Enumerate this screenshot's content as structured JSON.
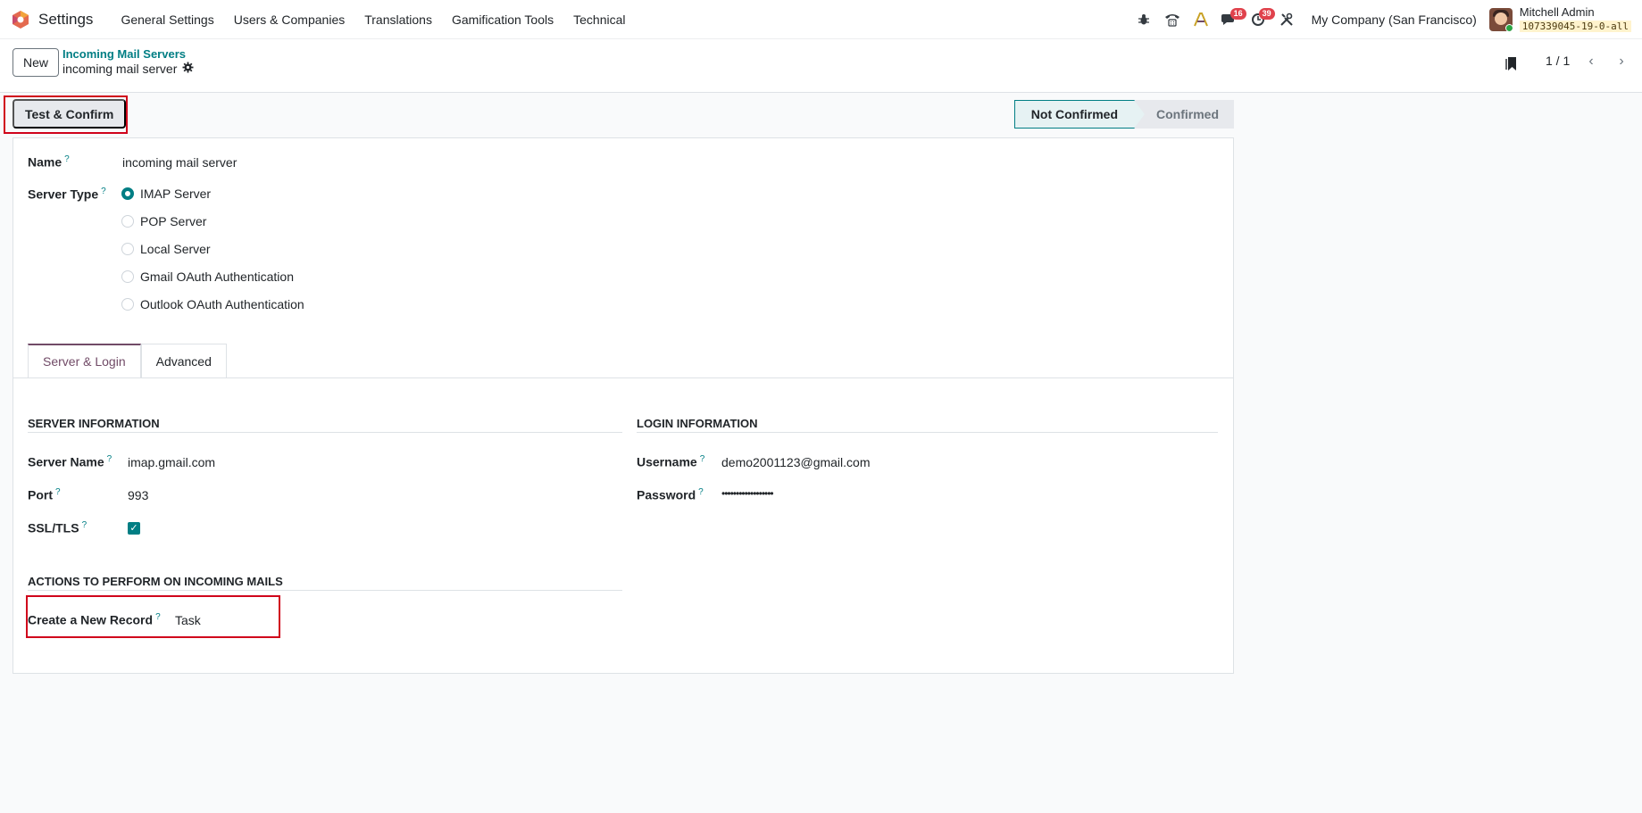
{
  "navbar": {
    "app_name": "Settings",
    "menu": [
      "General Settings",
      "Users & Companies",
      "Translations",
      "Gamification Tools",
      "Technical"
    ],
    "icons": [
      "bug-icon",
      "phone-icon",
      "ai-icon",
      "chat-icon",
      "clock-icon",
      "tools-icon"
    ],
    "messages_badge": "16",
    "activities_badge": "39",
    "company": "My Company (San Francisco)",
    "user_name": "Mitchell Admin",
    "database": "107339045-19-0-all"
  },
  "control_panel": {
    "new_label": "New",
    "breadcrumb_parent": "Incoming Mail Servers",
    "breadcrumb_current": "incoming mail server",
    "pager": "1 / 1"
  },
  "statusbar": {
    "test_button": "Test & Confirm",
    "stage_active": "Not Confirmed",
    "stage_next": "Confirmed"
  },
  "form": {
    "name_label": "Name",
    "name_value": "incoming mail server",
    "server_type_label": "Server Type",
    "server_types": [
      "IMAP Server",
      "POP Server",
      "Local Server",
      "Gmail OAuth Authentication",
      "Outlook OAuth Authentication"
    ],
    "tabs": [
      "Server & Login",
      "Advanced"
    ],
    "server_info_title": "SERVER INFORMATION",
    "server_name_label": "Server Name",
    "server_name_value": "imap.gmail.com",
    "port_label": "Port",
    "port_value": "993",
    "ssl_label": "SSL/TLS",
    "login_info_title": "LOGIN INFORMATION",
    "username_label": "Username",
    "username_value": "demo2001123@gmail.com",
    "password_label": "Password",
    "password_value": "••••••••••••••••••",
    "actions_title": "ACTIONS TO PERFORM ON INCOMING MAILS",
    "create_record_label": "Create a New Record",
    "create_record_value": "Task"
  },
  "colors": {
    "accent": "#017e84",
    "brand": "#714b67",
    "highlight": "#d0021b"
  }
}
